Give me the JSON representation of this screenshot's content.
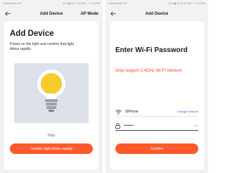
{
  "screen1": {
    "status": {
      "carrier": "China Mobile 4G",
      "right": "N ⚲ ▦ 4G ✆ 54 000 ⚡ 1:19 PM"
    },
    "header": {
      "back_icon": "arrow-left-icon",
      "title": "Add Device",
      "action": "AP Mode"
    },
    "content": {
      "title": "Add Device",
      "description": "Power on the light and confirm that light blinks rapidly",
      "illustration": "light-bulb-icon",
      "help": "Help",
      "confirm_button": "Confirm light blinks rapidly"
    },
    "colors": {
      "accent": "#ff5a2c",
      "panel": "#dde1ea",
      "bulb": "#f6cb2b"
    }
  },
  "screen2": {
    "status": {
      "carrier": "China Mobile 4G",
      "right": "N ⚲ ▦ 4G ✆ 54 000 ⚡ 1:19 PM"
    },
    "header": {
      "back_icon": "arrow-left-icon",
      "title": "Add Device"
    },
    "content": {
      "title": "Enter Wi-Fi Password",
      "warning": "Only support 2.4GHz Wi-Fi network",
      "wifi_icon": "wifi-icon",
      "ssid": "ZiPhone",
      "change_network": "Change Network",
      "lock_icon": "lock-icon",
      "password_value": "••••••••",
      "eye_icon": "eye-hidden-icon",
      "confirm_button": "Confirm"
    },
    "colors": {
      "warning": "#ff4a2a",
      "link": "#2a66c9",
      "accent": "#ff5a2c"
    }
  }
}
